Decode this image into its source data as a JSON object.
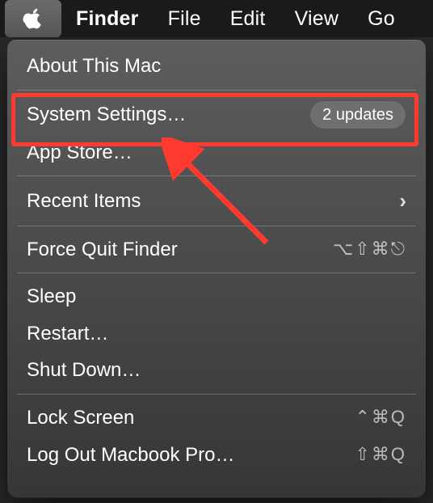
{
  "menubar": {
    "app_name": "Finder",
    "items": [
      "File",
      "Edit",
      "View",
      "Go"
    ]
  },
  "menu": {
    "about": "About This Mac",
    "system_settings": "System Settings…",
    "system_settings_badge": "2 updates",
    "app_store": "App Store…",
    "recent_items": "Recent Items",
    "force_quit": "Force Quit Finder",
    "force_quit_shortcut": "⌥⇧⌘⎋",
    "sleep": "Sleep",
    "restart": "Restart…",
    "shut_down": "Shut Down…",
    "lock_screen": "Lock Screen",
    "lock_screen_shortcut": "⌃⌘Q",
    "log_out": "Log Out Macbook Pro…",
    "log_out_shortcut": "⇧⌘Q"
  },
  "annotation": {
    "color": "#ff3b2f"
  }
}
